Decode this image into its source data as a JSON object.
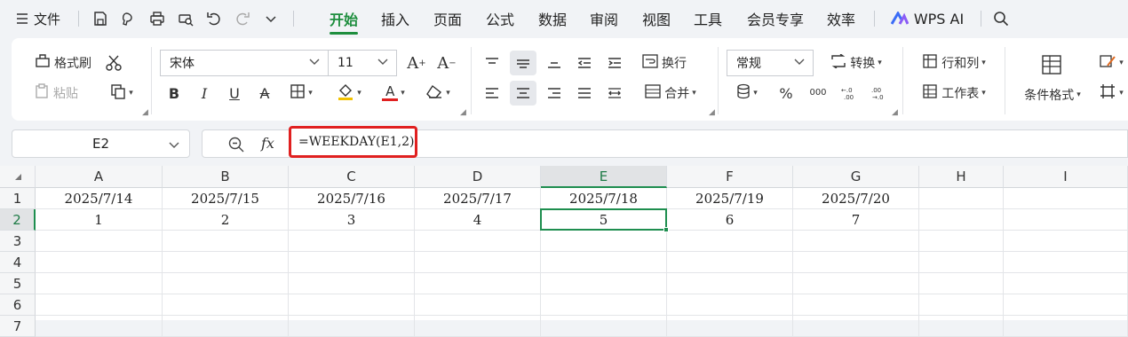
{
  "menubar": {
    "file_label": "文件",
    "tabs": [
      "开始",
      "插入",
      "页面",
      "公式",
      "数据",
      "审阅",
      "视图",
      "工具",
      "会员专享",
      "效率"
    ],
    "active_tab": "开始",
    "ai_label": "WPS AI",
    "icons": [
      "menu-icon",
      "save-icon",
      "brush-icon",
      "print-icon",
      "print-preview-icon",
      "undo-icon",
      "redo-icon",
      "more-icon",
      "search-icon"
    ]
  },
  "ribbon": {
    "format_painter": "格式刷",
    "paste": "粘贴",
    "font_name": "宋体",
    "font_size": "11",
    "wrap": "换行",
    "merge": "合并",
    "number_format": "常规",
    "convert": "转换",
    "rows_cols": "行和列",
    "worksheet": "工作表",
    "conditional_format": "条件格式",
    "bold": "B",
    "italic": "I",
    "underline": "U",
    "strike": "A",
    "font_color_letter": "A",
    "percent": "%",
    "thousands": "000",
    "font_grow": "A",
    "font_shrink": "A",
    "accent_color": "#1e8e3e",
    "font_color": "#e02020"
  },
  "formula_bar": {
    "name_box": "E2",
    "fx_label": "fx",
    "formula": "=WEEKDAY(E1,2)"
  },
  "sheet": {
    "columns": [
      "A",
      "B",
      "C",
      "D",
      "E",
      "F",
      "G",
      "H",
      "I"
    ],
    "rows": [
      "1",
      "2",
      "3",
      "4",
      "5",
      "6",
      "7"
    ],
    "row1": [
      "2025/7/14",
      "2025/7/15",
      "2025/7/16",
      "2025/7/17",
      "2025/7/18",
      "2025/7/19",
      "2025/7/20",
      "",
      ""
    ],
    "row2": [
      "1",
      "2",
      "3",
      "4",
      "5",
      "6",
      "7",
      "",
      ""
    ],
    "selected_cell": "E2",
    "selection_color": "#1e8e4f"
  }
}
